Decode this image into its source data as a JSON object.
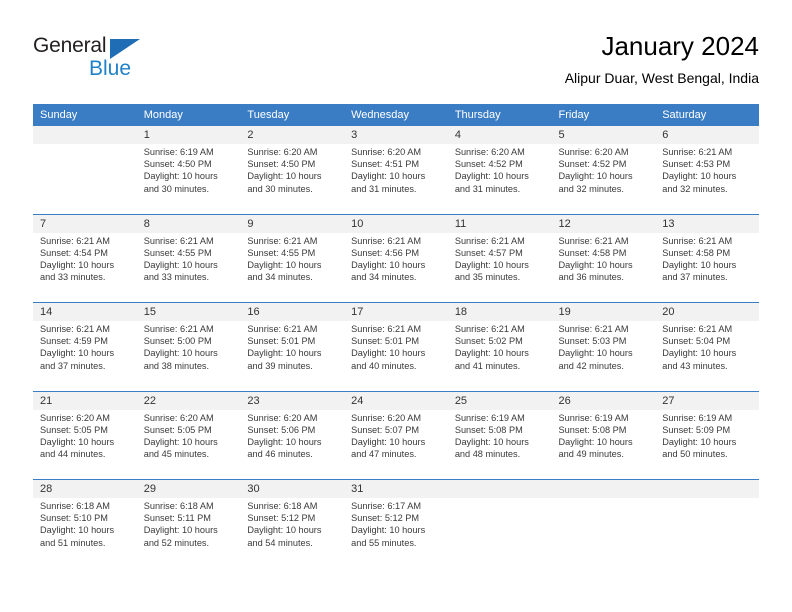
{
  "brand": {
    "name_part1": "General",
    "name_part2": "Blue",
    "triangle_color": "#1f6db5",
    "blue_text_color": "#2181c8"
  },
  "header": {
    "title": "January 2024",
    "subtitle": "Alipur Duar, West Bengal, India"
  },
  "theme": {
    "header_blue": "#3b7dc4",
    "daynum_band": "#f2f2f2",
    "body_text": "#3a3a3a"
  },
  "weekday_headers": [
    "Sunday",
    "Monday",
    "Tuesday",
    "Wednesday",
    "Thursday",
    "Friday",
    "Saturday"
  ],
  "weeks": [
    {
      "days": [
        {
          "num": "",
          "sunrise": "",
          "sunset": "",
          "daylight_1": "",
          "daylight_2": ""
        },
        {
          "num": "1",
          "sunrise": "Sunrise: 6:19 AM",
          "sunset": "Sunset: 4:50 PM",
          "daylight_1": "Daylight: 10 hours",
          "daylight_2": "and 30 minutes."
        },
        {
          "num": "2",
          "sunrise": "Sunrise: 6:20 AM",
          "sunset": "Sunset: 4:50 PM",
          "daylight_1": "Daylight: 10 hours",
          "daylight_2": "and 30 minutes."
        },
        {
          "num": "3",
          "sunrise": "Sunrise: 6:20 AM",
          "sunset": "Sunset: 4:51 PM",
          "daylight_1": "Daylight: 10 hours",
          "daylight_2": "and 31 minutes."
        },
        {
          "num": "4",
          "sunrise": "Sunrise: 6:20 AM",
          "sunset": "Sunset: 4:52 PM",
          "daylight_1": "Daylight: 10 hours",
          "daylight_2": "and 31 minutes."
        },
        {
          "num": "5",
          "sunrise": "Sunrise: 6:20 AM",
          "sunset": "Sunset: 4:52 PM",
          "daylight_1": "Daylight: 10 hours",
          "daylight_2": "and 32 minutes."
        },
        {
          "num": "6",
          "sunrise": "Sunrise: 6:21 AM",
          "sunset": "Sunset: 4:53 PM",
          "daylight_1": "Daylight: 10 hours",
          "daylight_2": "and 32 minutes."
        }
      ]
    },
    {
      "days": [
        {
          "num": "7",
          "sunrise": "Sunrise: 6:21 AM",
          "sunset": "Sunset: 4:54 PM",
          "daylight_1": "Daylight: 10 hours",
          "daylight_2": "and 33 minutes."
        },
        {
          "num": "8",
          "sunrise": "Sunrise: 6:21 AM",
          "sunset": "Sunset: 4:55 PM",
          "daylight_1": "Daylight: 10 hours",
          "daylight_2": "and 33 minutes."
        },
        {
          "num": "9",
          "sunrise": "Sunrise: 6:21 AM",
          "sunset": "Sunset: 4:55 PM",
          "daylight_1": "Daylight: 10 hours",
          "daylight_2": "and 34 minutes."
        },
        {
          "num": "10",
          "sunrise": "Sunrise: 6:21 AM",
          "sunset": "Sunset: 4:56 PM",
          "daylight_1": "Daylight: 10 hours",
          "daylight_2": "and 34 minutes."
        },
        {
          "num": "11",
          "sunrise": "Sunrise: 6:21 AM",
          "sunset": "Sunset: 4:57 PM",
          "daylight_1": "Daylight: 10 hours",
          "daylight_2": "and 35 minutes."
        },
        {
          "num": "12",
          "sunrise": "Sunrise: 6:21 AM",
          "sunset": "Sunset: 4:58 PM",
          "daylight_1": "Daylight: 10 hours",
          "daylight_2": "and 36 minutes."
        },
        {
          "num": "13",
          "sunrise": "Sunrise: 6:21 AM",
          "sunset": "Sunset: 4:58 PM",
          "daylight_1": "Daylight: 10 hours",
          "daylight_2": "and 37 minutes."
        }
      ]
    },
    {
      "days": [
        {
          "num": "14",
          "sunrise": "Sunrise: 6:21 AM",
          "sunset": "Sunset: 4:59 PM",
          "daylight_1": "Daylight: 10 hours",
          "daylight_2": "and 37 minutes."
        },
        {
          "num": "15",
          "sunrise": "Sunrise: 6:21 AM",
          "sunset": "Sunset: 5:00 PM",
          "daylight_1": "Daylight: 10 hours",
          "daylight_2": "and 38 minutes."
        },
        {
          "num": "16",
          "sunrise": "Sunrise: 6:21 AM",
          "sunset": "Sunset: 5:01 PM",
          "daylight_1": "Daylight: 10 hours",
          "daylight_2": "and 39 minutes."
        },
        {
          "num": "17",
          "sunrise": "Sunrise: 6:21 AM",
          "sunset": "Sunset: 5:01 PM",
          "daylight_1": "Daylight: 10 hours",
          "daylight_2": "and 40 minutes."
        },
        {
          "num": "18",
          "sunrise": "Sunrise: 6:21 AM",
          "sunset": "Sunset: 5:02 PM",
          "daylight_1": "Daylight: 10 hours",
          "daylight_2": "and 41 minutes."
        },
        {
          "num": "19",
          "sunrise": "Sunrise: 6:21 AM",
          "sunset": "Sunset: 5:03 PM",
          "daylight_1": "Daylight: 10 hours",
          "daylight_2": "and 42 minutes."
        },
        {
          "num": "20",
          "sunrise": "Sunrise: 6:21 AM",
          "sunset": "Sunset: 5:04 PM",
          "daylight_1": "Daylight: 10 hours",
          "daylight_2": "and 43 minutes."
        }
      ]
    },
    {
      "days": [
        {
          "num": "21",
          "sunrise": "Sunrise: 6:20 AM",
          "sunset": "Sunset: 5:05 PM",
          "daylight_1": "Daylight: 10 hours",
          "daylight_2": "and 44 minutes."
        },
        {
          "num": "22",
          "sunrise": "Sunrise: 6:20 AM",
          "sunset": "Sunset: 5:05 PM",
          "daylight_1": "Daylight: 10 hours",
          "daylight_2": "and 45 minutes."
        },
        {
          "num": "23",
          "sunrise": "Sunrise: 6:20 AM",
          "sunset": "Sunset: 5:06 PM",
          "daylight_1": "Daylight: 10 hours",
          "daylight_2": "and 46 minutes."
        },
        {
          "num": "24",
          "sunrise": "Sunrise: 6:20 AM",
          "sunset": "Sunset: 5:07 PM",
          "daylight_1": "Daylight: 10 hours",
          "daylight_2": "and 47 minutes."
        },
        {
          "num": "25",
          "sunrise": "Sunrise: 6:19 AM",
          "sunset": "Sunset: 5:08 PM",
          "daylight_1": "Daylight: 10 hours",
          "daylight_2": "and 48 minutes."
        },
        {
          "num": "26",
          "sunrise": "Sunrise: 6:19 AM",
          "sunset": "Sunset: 5:08 PM",
          "daylight_1": "Daylight: 10 hours",
          "daylight_2": "and 49 minutes."
        },
        {
          "num": "27",
          "sunrise": "Sunrise: 6:19 AM",
          "sunset": "Sunset: 5:09 PM",
          "daylight_1": "Daylight: 10 hours",
          "daylight_2": "and 50 minutes."
        }
      ]
    },
    {
      "days": [
        {
          "num": "28",
          "sunrise": "Sunrise: 6:18 AM",
          "sunset": "Sunset: 5:10 PM",
          "daylight_1": "Daylight: 10 hours",
          "daylight_2": "and 51 minutes."
        },
        {
          "num": "29",
          "sunrise": "Sunrise: 6:18 AM",
          "sunset": "Sunset: 5:11 PM",
          "daylight_1": "Daylight: 10 hours",
          "daylight_2": "and 52 minutes."
        },
        {
          "num": "30",
          "sunrise": "Sunrise: 6:18 AM",
          "sunset": "Sunset: 5:12 PM",
          "daylight_1": "Daylight: 10 hours",
          "daylight_2": "and 54 minutes."
        },
        {
          "num": "31",
          "sunrise": "Sunrise: 6:17 AM",
          "sunset": "Sunset: 5:12 PM",
          "daylight_1": "Daylight: 10 hours",
          "daylight_2": "and 55 minutes."
        },
        {
          "num": "",
          "sunrise": "",
          "sunset": "",
          "daylight_1": "",
          "daylight_2": ""
        },
        {
          "num": "",
          "sunrise": "",
          "sunset": "",
          "daylight_1": "",
          "daylight_2": ""
        },
        {
          "num": "",
          "sunrise": "",
          "sunset": "",
          "daylight_1": "",
          "daylight_2": ""
        }
      ]
    }
  ]
}
